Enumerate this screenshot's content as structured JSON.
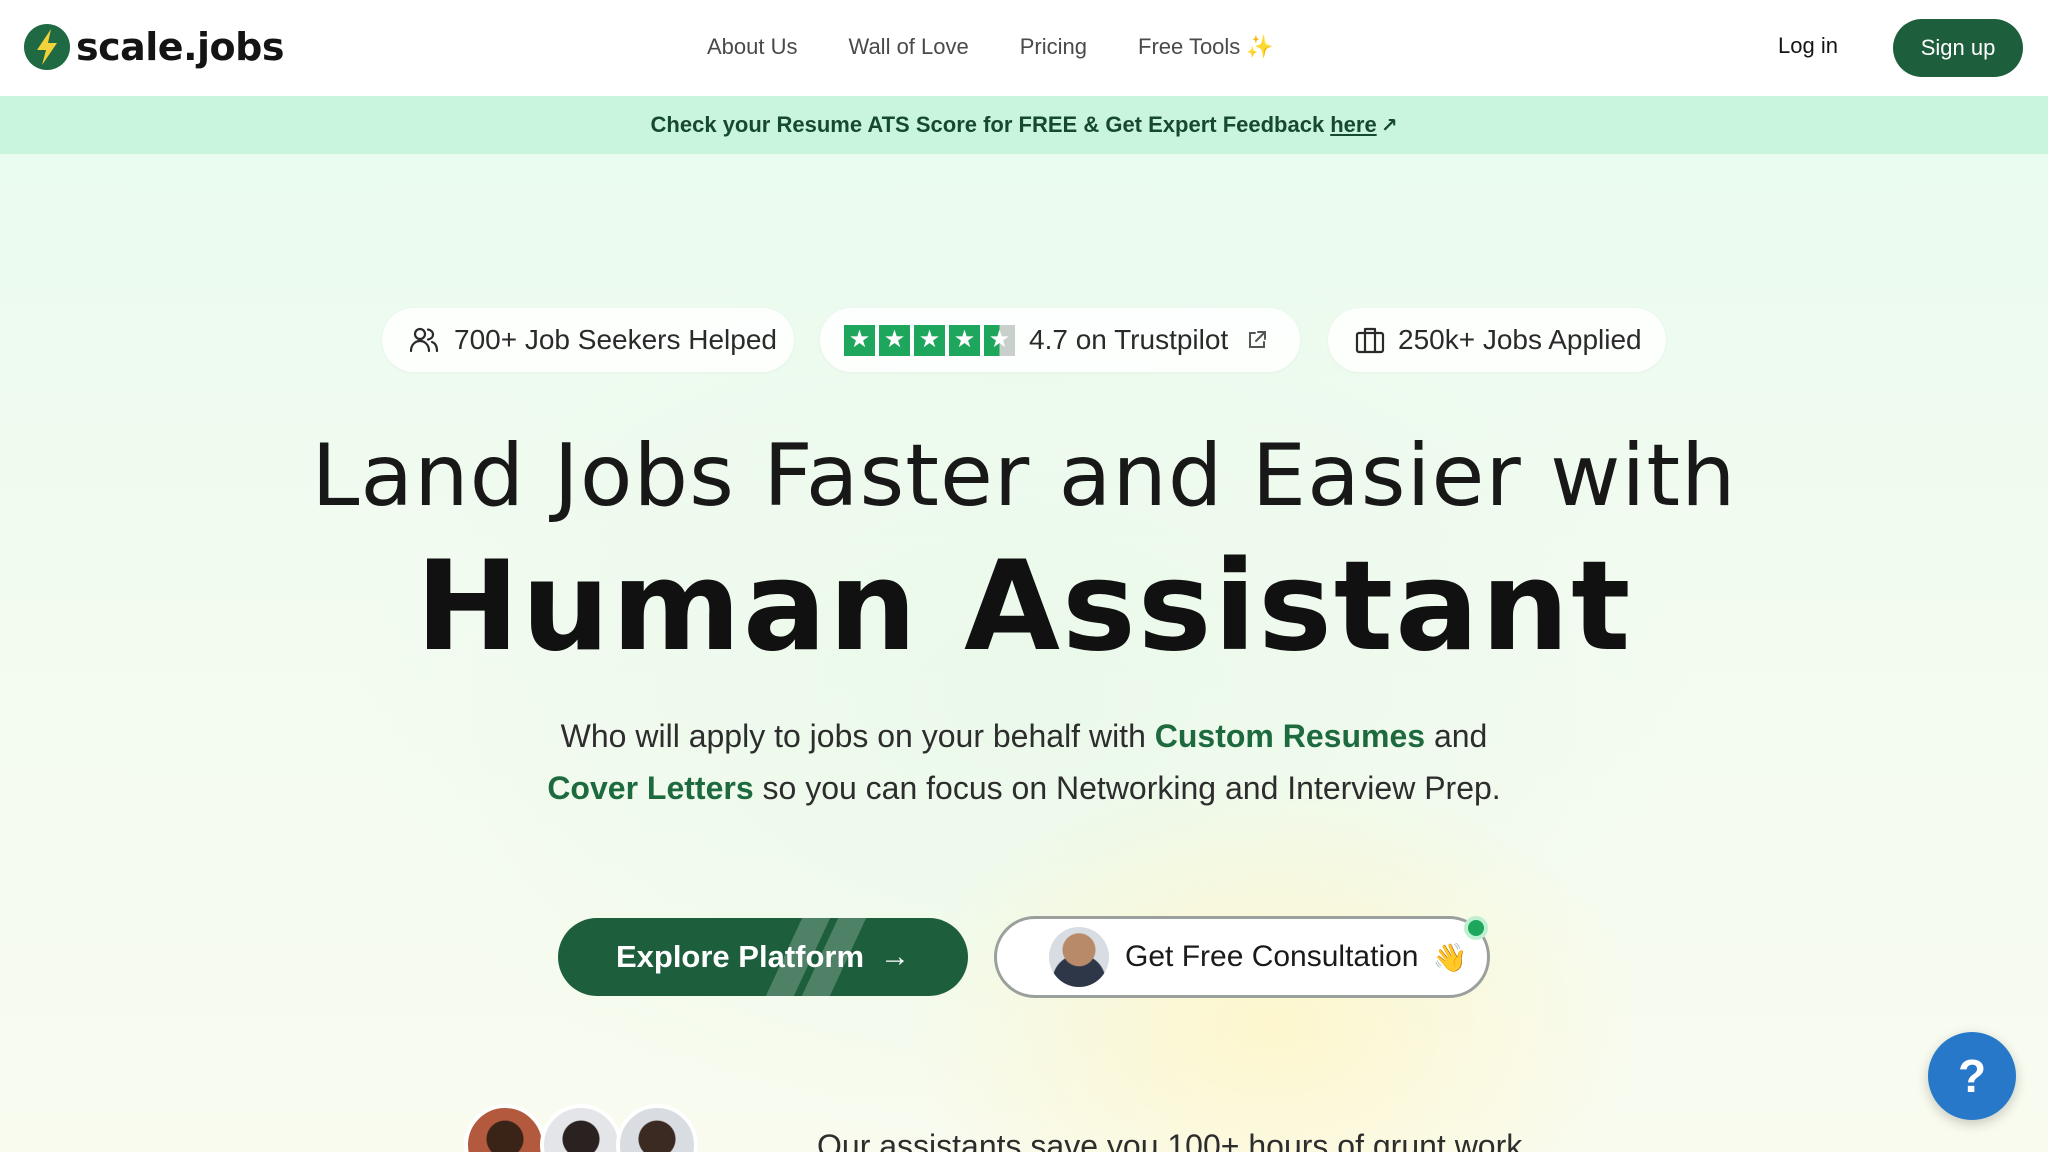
{
  "brand": {
    "name": "scale.jobs",
    "logo_icon": "lightning-bolt-icon"
  },
  "nav": {
    "links": [
      "About Us",
      "Wall of Love",
      "Pricing",
      "Free Tools"
    ],
    "free_tools_icon": "sparkle-icon",
    "login": "Log in",
    "signup": "Sign up"
  },
  "banner": {
    "text": "Check your Resume ATS Score for FREE & Get Expert Feedback",
    "link": "here",
    "link_icon": "external-arrow-icon"
  },
  "stats": {
    "seekers": "700+ Job Seekers Helped",
    "trustpilot": "4.7 on Trustpilot",
    "trustpilot_rating": 4.5,
    "jobs": "250k+ Jobs Applied"
  },
  "hero": {
    "headline_1": "Land Jobs Faster and Easier with",
    "headline_2": "Human Assistant",
    "sub_1a": "Who will apply to jobs on your behalf with ",
    "sub_1b": "Custom Resumes",
    "sub_1c": " and",
    "sub_2a": "Cover Letters",
    "sub_2b": " so you can focus on Networking and Interview Prep."
  },
  "cta": {
    "explore": "Explore Platform",
    "consult": "Get Free Consultation"
  },
  "proof": {
    "text": "Our assistants save you 100+ hours of grunt work"
  },
  "help_button": "?",
  "colors": {
    "brand_green": "#1d5e3c",
    "banner_bg": "#c9f5dc",
    "accent_text": "#1d6a3f",
    "help_blue": "#2878c9"
  }
}
